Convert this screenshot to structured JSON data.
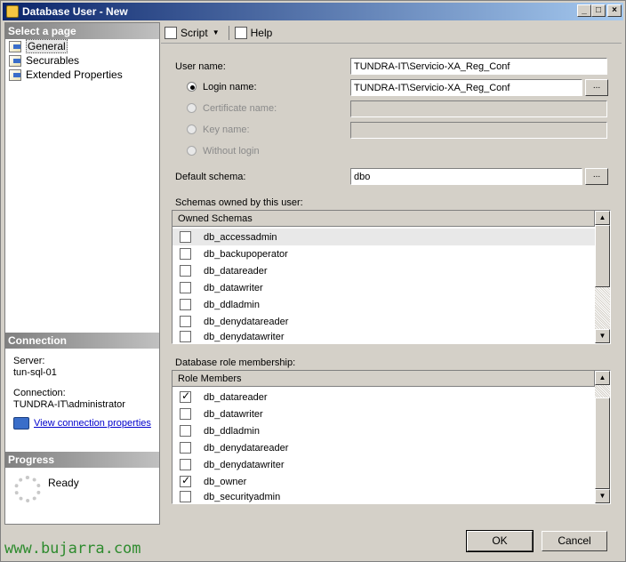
{
  "window": {
    "title": "Database User - New"
  },
  "left": {
    "select_page_header": "Select a page",
    "pages": [
      {
        "label": "General"
      },
      {
        "label": "Securables"
      },
      {
        "label": "Extended Properties"
      }
    ],
    "connection_header": "Connection",
    "server_label": "Server:",
    "server_value": "tun-sql-01",
    "connection_label": "Connection:",
    "connection_value": "TUNDRA-IT\\administrator",
    "view_link": "View connection properties",
    "progress_header": "Progress",
    "progress_status": "Ready"
  },
  "toolbar": {
    "script_label": "Script",
    "help_label": "Help"
  },
  "form": {
    "user_name_label": "User name:",
    "user_name_value": "TUNDRA-IT\\Servicio-XA_Reg_Conf",
    "login_name_label": "Login name:",
    "login_name_value": "TUNDRA-IT\\Servicio-XA_Reg_Conf",
    "certificate_label": "Certificate name:",
    "key_label": "Key name:",
    "without_login_label": "Without login",
    "default_schema_label": "Default schema:",
    "default_schema_value": "dbo",
    "browse_label": "...",
    "schemas_label": "Schemas owned by this user:",
    "schemas_header": "Owned Schemas",
    "schemas": [
      {
        "name": "db_accessadmin",
        "checked": false
      },
      {
        "name": "db_backupoperator",
        "checked": false
      },
      {
        "name": "db_datareader",
        "checked": false
      },
      {
        "name": "db_datawriter",
        "checked": false
      },
      {
        "name": "db_ddladmin",
        "checked": false
      },
      {
        "name": "db_denydatareader",
        "checked": false
      },
      {
        "name": "db_denydatawriter",
        "checked": false
      }
    ],
    "roles_label": "Database role membership:",
    "roles_header": "Role Members",
    "roles": [
      {
        "name": "db_datareader",
        "checked": true
      },
      {
        "name": "db_datawriter",
        "checked": false
      },
      {
        "name": "db_ddladmin",
        "checked": false
      },
      {
        "name": "db_denydatareader",
        "checked": false
      },
      {
        "name": "db_denydatawriter",
        "checked": false
      },
      {
        "name": "db_owner",
        "checked": true
      },
      {
        "name": "db_securityadmin",
        "checked": false
      }
    ]
  },
  "buttons": {
    "ok": "OK",
    "cancel": "Cancel"
  },
  "watermark": "www.bujarra.com"
}
